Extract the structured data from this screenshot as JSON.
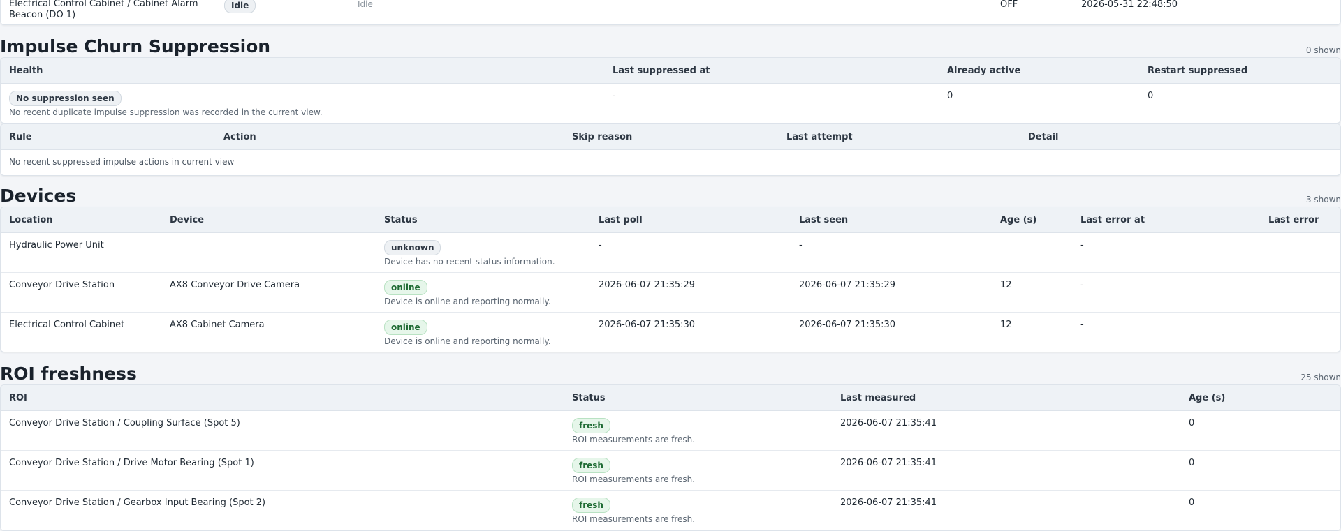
{
  "top_row": {
    "name_line1": "Electrical Control Cabinet / Cabinet Alarm",
    "name_line2": "Beacon (DO 1)",
    "badge": "Idle",
    "state_text": "Idle",
    "value": "OFF",
    "timestamp": "2026-05-31 22:48:50"
  },
  "impulse": {
    "title": "Impulse Churn Suppression",
    "shown": "0 shown",
    "health_columns": [
      "Health",
      "Last suppressed at",
      "Already active",
      "Restart suppressed"
    ],
    "health_row": {
      "badge": "No suppression seen",
      "note": "No recent duplicate impulse suppression was recorded in the current view.",
      "last_suppressed": "-",
      "already_active": "0",
      "restart_suppressed": "0"
    },
    "rule_columns": [
      "Rule",
      "Action",
      "Skip reason",
      "Last attempt",
      "Detail"
    ],
    "empty_text": "No recent suppressed impulse actions in current view"
  },
  "devices": {
    "title": "Devices",
    "shown": "3 shown",
    "columns": [
      "Location",
      "Device",
      "Status",
      "Last poll",
      "Last seen",
      "Age (s)",
      "Last error at",
      "Last error"
    ],
    "rows": [
      {
        "location": "Hydraulic Power Unit",
        "device": "",
        "status": "unknown",
        "status_note": "Device has no recent status information.",
        "last_poll": "-",
        "last_seen": "-",
        "age": "",
        "last_error_at": "-",
        "last_error": ""
      },
      {
        "location": "Conveyor Drive Station",
        "device": "AX8 Conveyor Drive Camera",
        "status": "online",
        "status_note": "Device is online and reporting normally.",
        "last_poll": "2026-06-07 21:35:29",
        "last_seen": "2026-06-07 21:35:29",
        "age": "12",
        "last_error_at": "-",
        "last_error": ""
      },
      {
        "location": "Electrical Control Cabinet",
        "device": "AX8 Cabinet Camera",
        "status": "online",
        "status_note": "Device is online and reporting normally.",
        "last_poll": "2026-06-07 21:35:30",
        "last_seen": "2026-06-07 21:35:30",
        "age": "12",
        "last_error_at": "-",
        "last_error": ""
      }
    ]
  },
  "roi": {
    "title": "ROI freshness",
    "shown": "25 shown",
    "columns": [
      "ROI",
      "Status",
      "Last measured",
      "Age (s)"
    ],
    "rows": [
      {
        "roi": "Conveyor Drive Station / Coupling Surface (Spot 5)",
        "status": "fresh",
        "status_note": "ROI measurements are fresh.",
        "last_measured": "2026-06-07 21:35:41",
        "age": "0"
      },
      {
        "roi": "Conveyor Drive Station / Drive Motor Bearing (Spot 1)",
        "status": "fresh",
        "status_note": "ROI measurements are fresh.",
        "last_measured": "2026-06-07 21:35:41",
        "age": "0"
      },
      {
        "roi": "Conveyor Drive Station / Gearbox Input Bearing (Spot 2)",
        "status": "fresh",
        "status_note": "ROI measurements are fresh.",
        "last_measured": "2026-06-07 21:35:41",
        "age": "0"
      }
    ]
  },
  "colors": {
    "badge_green_bg": "#e6f6ea",
    "badge_green_text": "#1e6b33",
    "badge_grey_bg": "#eef1f4",
    "header_bg": "#eef2f6",
    "page_bg": "#f3f5f8"
  }
}
